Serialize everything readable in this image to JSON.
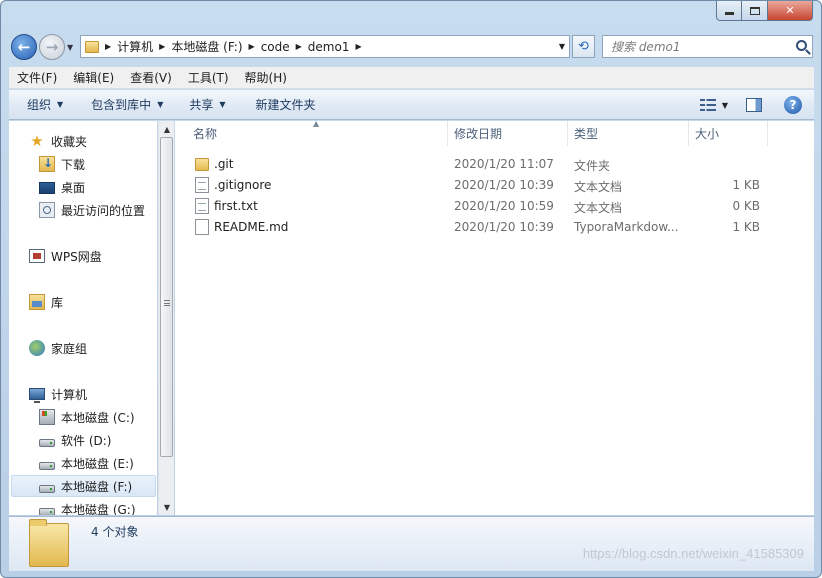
{
  "window": {
    "caption": {
      "minimize_icon": "minimize-icon",
      "maximize_icon": "maximize-icon",
      "close_glyph": "✕"
    }
  },
  "address": {
    "crumbs": [
      "计算机",
      "本地磁盘 (F:)",
      "code",
      "demo1"
    ],
    "refresh_glyph": "⟲"
  },
  "search": {
    "placeholder": "搜索 demo1"
  },
  "menubar": {
    "items": [
      "文件(F)",
      "编辑(E)",
      "查看(V)",
      "工具(T)",
      "帮助(H)"
    ]
  },
  "commandbar": {
    "organize": "组织",
    "include_in_library": "包含到库中",
    "share": "共享",
    "new_folder": "新建文件夹",
    "help_glyph": "?"
  },
  "navpane": {
    "favorites": "收藏夹",
    "downloads": "下载",
    "desktop": "桌面",
    "recent": "最近访问的位置",
    "wps": "WPS网盘",
    "libraries": "库",
    "homegroup": "家庭组",
    "computer": "计算机",
    "drives": [
      "本地磁盘 (C:)",
      "软件 (D:)",
      "本地磁盘 (E:)",
      "本地磁盘 (F:)",
      "本地磁盘 (G:)"
    ],
    "selected_drive": "本地磁盘 (F:)"
  },
  "filelist": {
    "columns": {
      "name": "名称",
      "modified": "修改日期",
      "type": "类型",
      "size": "大小"
    },
    "sort_column": "名称",
    "rows": [
      {
        "name": ".git",
        "modified": "2020/1/20 11:07",
        "type": "文件夹",
        "size": "",
        "icon": "folder-icon"
      },
      {
        "name": ".gitignore",
        "modified": "2020/1/20 10:39",
        "type": "文本文档",
        "size": "1 KB",
        "icon": "text-file-icon"
      },
      {
        "name": "first.txt",
        "modified": "2020/1/20 10:59",
        "type": "文本文档",
        "size": "0 KB",
        "icon": "text-file-icon"
      },
      {
        "name": "README.md",
        "modified": "2020/1/20 10:39",
        "type": "TyporaMarkdow...",
        "size": "1 KB",
        "icon": "file-icon"
      }
    ]
  },
  "details": {
    "count_text": "4 个对象"
  },
  "watermark": "https://blog.csdn.net/weixin_41585309",
  "colors": {
    "accent": "#2a6bb8",
    "chrome": "#c8dcef",
    "selection": "#d9e7f6"
  }
}
